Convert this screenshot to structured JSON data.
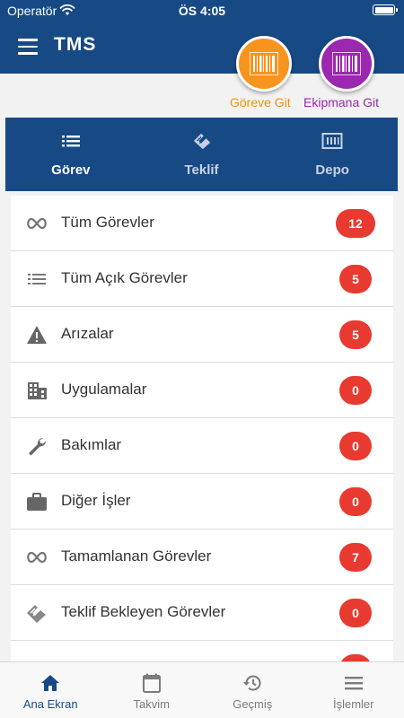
{
  "status_bar": {
    "carrier": "Operatör",
    "time": "ÖS 4:05"
  },
  "header": {
    "title": "TMS",
    "fab_orange_label": "Göreve Git",
    "fab_purple_label": "Ekipmana Git"
  },
  "colors": {
    "primary": "#174a85",
    "orange": "#f7941d",
    "purple": "#9c27b0",
    "badge": "#e83a30"
  },
  "tabs": [
    {
      "label": "Görev",
      "icon": "list-icon",
      "active": true
    },
    {
      "label": "Teklif",
      "icon": "handshake-icon",
      "active": false
    },
    {
      "label": "Depo",
      "icon": "warehouse-icon",
      "active": false
    }
  ],
  "rows": [
    {
      "label": "Tüm Görevler",
      "count": "12",
      "icon": "infinity-icon"
    },
    {
      "label": "Tüm Açık Görevler",
      "count": "5",
      "icon": "list-icon"
    },
    {
      "label": "Arızalar",
      "count": "5",
      "icon": "warning-icon"
    },
    {
      "label": "Uygulamalar",
      "count": "0",
      "icon": "building-icon"
    },
    {
      "label": "Bakımlar",
      "count": "0",
      "icon": "wrench-icon"
    },
    {
      "label": "Diğer İşler",
      "count": "0",
      "icon": "briefcase-icon"
    },
    {
      "label": "Tamamlanan Görevler",
      "count": "7",
      "icon": "infinity-icon"
    },
    {
      "label": "Teklif Bekleyen Görevler",
      "count": "0",
      "icon": "handshake-icon"
    }
  ],
  "bottom_nav": [
    {
      "label": "Ana Ekran",
      "icon": "home-icon",
      "active": true
    },
    {
      "label": "Takvim",
      "icon": "calendar-icon",
      "active": false
    },
    {
      "label": "Geçmiş",
      "icon": "history-icon",
      "active": false
    },
    {
      "label": "İşlemler",
      "icon": "menu-icon",
      "active": false
    }
  ]
}
